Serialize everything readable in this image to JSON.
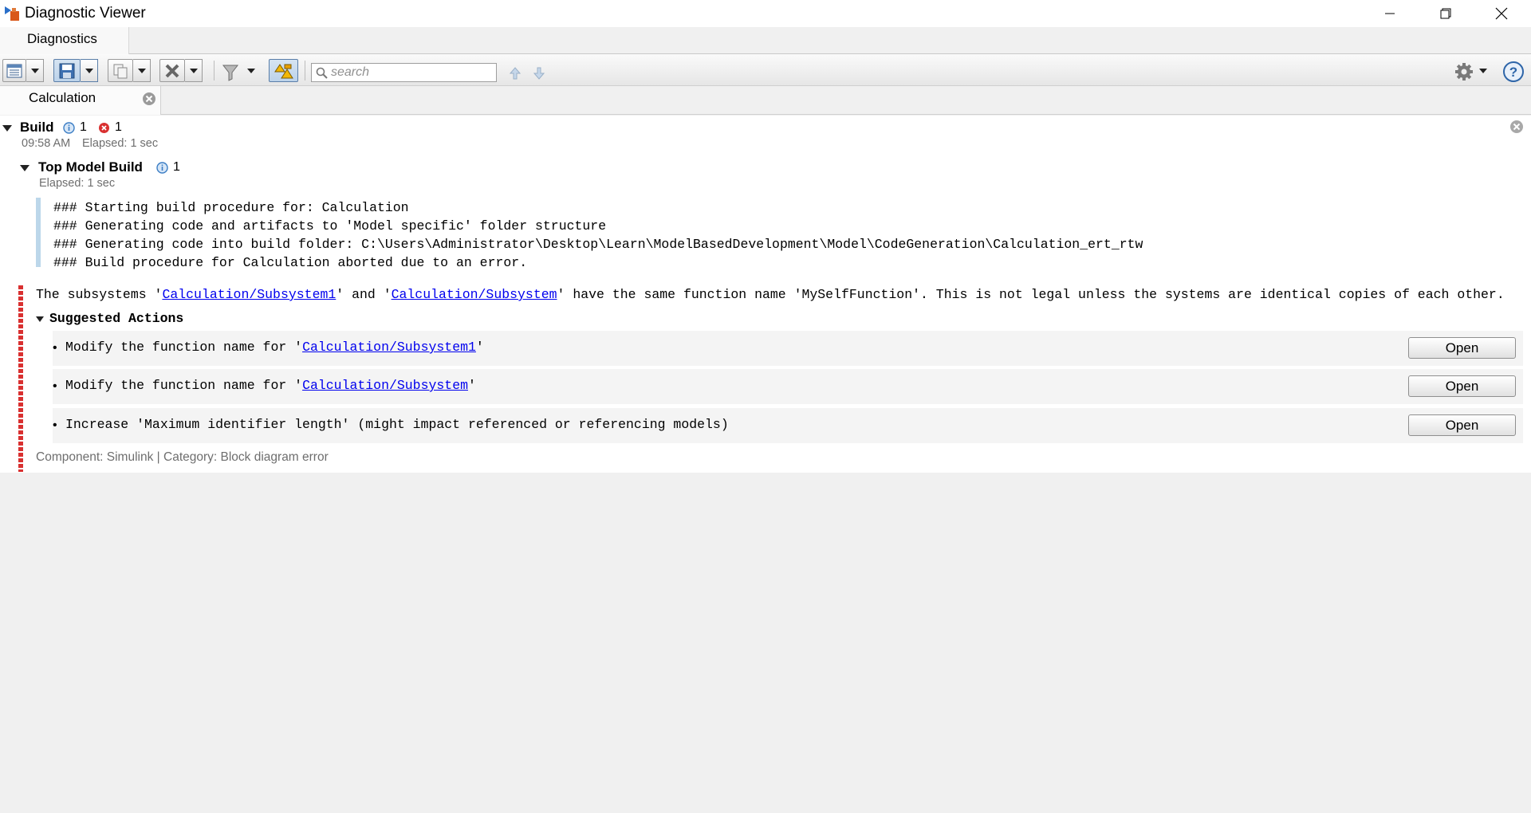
{
  "window": {
    "title": "Diagnostic Viewer"
  },
  "tabs": {
    "main": "Diagnostics"
  },
  "toolbar": {
    "search_placeholder": "search"
  },
  "model_tab": {
    "label": "Calculation"
  },
  "build": {
    "title": "Build",
    "info_count": "1",
    "error_count": "1",
    "time": "09:58 AM",
    "elapsed": "Elapsed: 1 sec",
    "top_model": {
      "title": "Top Model Build",
      "info_count": "1",
      "elapsed": "Elapsed: 1 sec",
      "log": [
        "### Starting build procedure for: Calculation",
        "### Generating code and artifacts to 'Model specific' folder structure",
        "### Generating code into build folder: C:\\Users\\Administrator\\Desktop\\Learn\\ModelBasedDevelopment\\Model\\CodeGeneration\\Calculation_ert_rtw",
        "### Build procedure for Calculation aborted due to an error."
      ]
    }
  },
  "error": {
    "msg_prefix": "The subsystems '",
    "link1": "Calculation/Subsystem1",
    "msg_mid": "' and '",
    "link2": "Calculation/Subsystem",
    "msg_suffix": "' have the same function name 'MySelfFunction'.  This is not legal unless the systems are identical copies of each other.",
    "suggested_title": "Suggested Actions",
    "actions": [
      {
        "prefix": "Modify the function name for '",
        "link": "Calculation/Subsystem1",
        "suffix": "'",
        "button": "Open"
      },
      {
        "prefix": "Modify the function name for '",
        "link": "Calculation/Subsystem",
        "suffix": "'",
        "button": "Open"
      },
      {
        "prefix": "Increase 'Maximum identifier length' (might impact referenced or referencing models)",
        "link": "",
        "suffix": "",
        "button": "Open"
      }
    ],
    "component_label": "Component:",
    "component_value": "Simulink",
    "separator": "|",
    "category_label": "Category:",
    "category_value": "Block diagram error"
  },
  "colors": {
    "link": "#0000ee",
    "error": "#d93030",
    "info": "#3b7dc4"
  }
}
